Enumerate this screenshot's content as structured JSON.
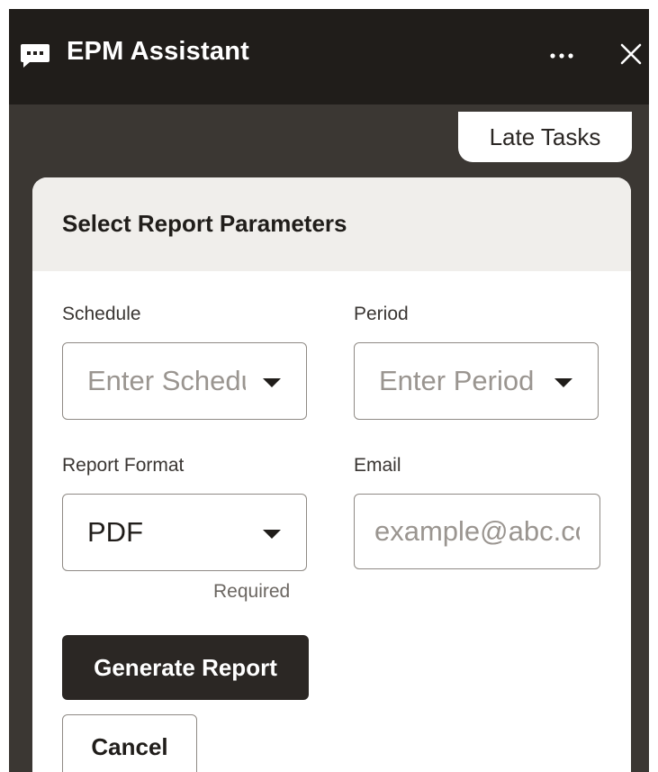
{
  "header": {
    "title": "EPM Assistant",
    "chat_icon": "chat-bubble-icon",
    "more_icon": "more-horizontal-icon",
    "close_icon": "close-icon"
  },
  "quick_reply": {
    "label": "Late Tasks"
  },
  "form": {
    "title": "Select Report Parameters",
    "schedule": {
      "label": "Schedule",
      "placeholder": "Enter Schedule"
    },
    "period": {
      "label": "Period",
      "placeholder": "Enter Period"
    },
    "report_format": {
      "label": "Report Format",
      "value": "PDF",
      "helper": "Required"
    },
    "email": {
      "label": "Email",
      "placeholder": "example@abc.com"
    },
    "generate_label": "Generate Report",
    "cancel_label": "Cancel"
  },
  "colors": {
    "header_bg": "#201d1a",
    "panel_bg": "#3b3733",
    "card_head_bg": "#f0eeeb",
    "primary_button": "#2b2724"
  }
}
